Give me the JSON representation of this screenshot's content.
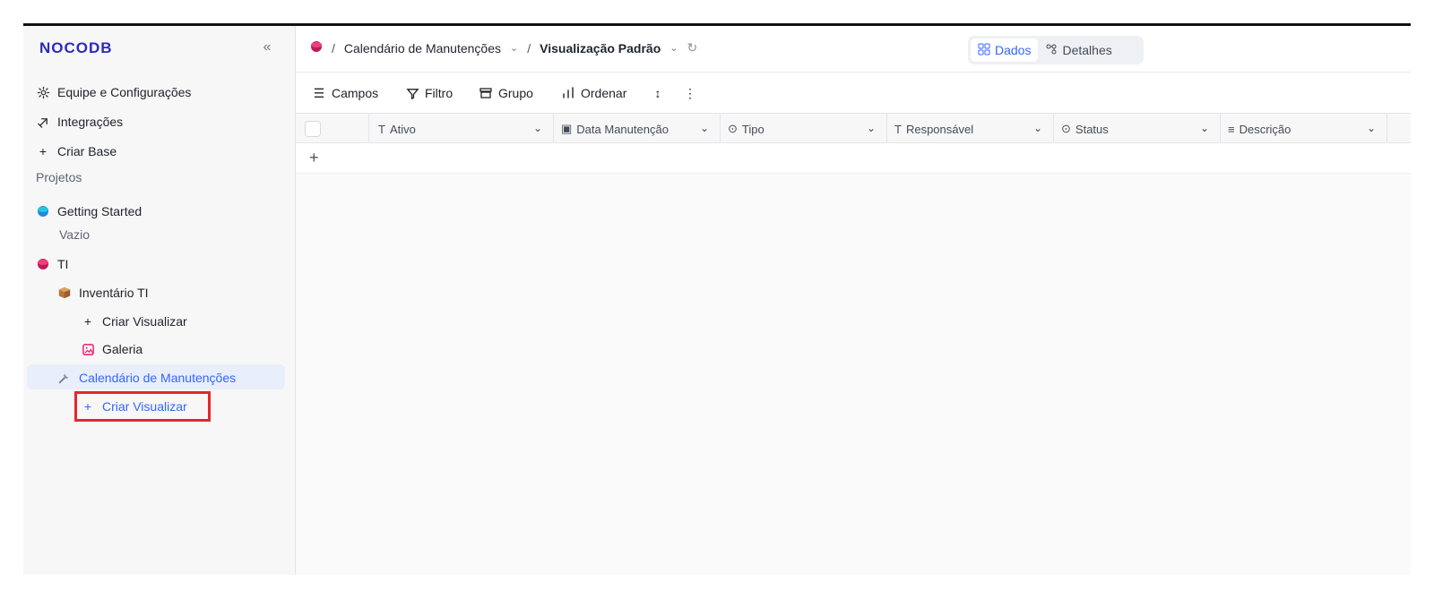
{
  "brand": {
    "logo": "NOCODB",
    "collapse": "«"
  },
  "sidebar": {
    "team_settings": "Equipe e Configurações",
    "integrations": "Integrações",
    "create_base": "Criar Base",
    "projects_title": "Projetos",
    "getting_started": "Getting Started",
    "empty": "Vazio",
    "ti": "TI",
    "inventory": "Inventário TI",
    "create_view_1": "Criar Visualizar",
    "gallery": "Galeria",
    "calendar": "Calendário de Manutenções",
    "create_view_2": "Criar Visualizar",
    "plus": "+"
  },
  "topbar": {
    "sep1": "/",
    "table_name": "Calendário de Manutenções",
    "sep2": "/",
    "view_name": "Visualização Padrão",
    "data_tab": "Dados",
    "details_tab": "Detalhes"
  },
  "toolbar": {
    "fields": "Campos",
    "filter": "Filtro",
    "group": "Grupo",
    "sort": "Ordenar"
  },
  "columns": {
    "active": "Ativo",
    "maintenance_date": "Data Manutenção",
    "type": "Tipo",
    "responsible": "Responsável",
    "status": "Status",
    "description": "Descrição"
  },
  "grid": {
    "add_row": "+"
  },
  "colors": {
    "accent": "#3366ff",
    "brand": "#2d2ab8",
    "highlight": "#e3282d"
  },
  "icons": [
    "gear-icon",
    "integration-icon",
    "plus-icon",
    "blue-base-icon",
    "pink-base-icon",
    "box-icon",
    "gallery-icon",
    "wrench-icon",
    "fields-icon",
    "filter-icon",
    "group-icon",
    "sort-icon",
    "row-height-icon",
    "more-icon",
    "text-icon",
    "calendar-icon",
    "select-icon",
    "description-icon",
    "refresh-icon"
  ]
}
